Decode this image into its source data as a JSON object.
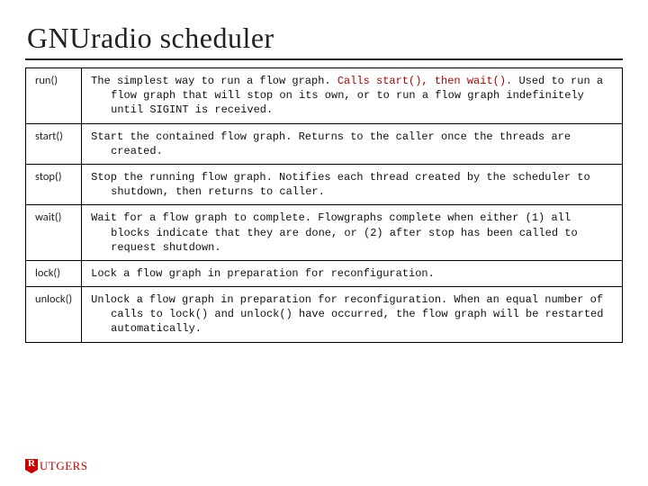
{
  "title": "GNUradio scheduler",
  "table": {
    "rows": [
      {
        "method": "run()",
        "desc_prefix": "The simplest way to run a flow graph. ",
        "desc_highlight": "Calls start(), then wait().",
        "desc_suffix": " Used to run a flow graph that will stop on its own, or to run a flow graph indefinitely until SIGINT is received."
      },
      {
        "method": "start()",
        "desc_prefix": "Start the contained flow graph. Returns to the caller once the threads are created.",
        "desc_highlight": "",
        "desc_suffix": ""
      },
      {
        "method": "stop()",
        "desc_prefix": "Stop the running flow graph. Notifies each thread created by the scheduler to shutdown, then returns to caller.",
        "desc_highlight": "",
        "desc_suffix": ""
      },
      {
        "method": "wait()",
        "desc_prefix": "Wait for a flow graph to complete. Flowgraphs complete when either (1) all blocks indicate that they are done, or (2) after stop has been called to request shutdown.",
        "desc_highlight": "",
        "desc_suffix": ""
      },
      {
        "method": "lock()",
        "desc_prefix": "Lock a flow graph in preparation for reconfiguration.",
        "desc_highlight": "",
        "desc_suffix": ""
      },
      {
        "method": "unlock()",
        "desc_prefix": "Unlock a flow graph in preparation for reconfiguration. When an equal number of calls to lock() and unlock() have occurred, the flow graph will be restarted automatically.",
        "desc_highlight": "",
        "desc_suffix": ""
      }
    ]
  },
  "logo": {
    "text": "UTGERS"
  }
}
